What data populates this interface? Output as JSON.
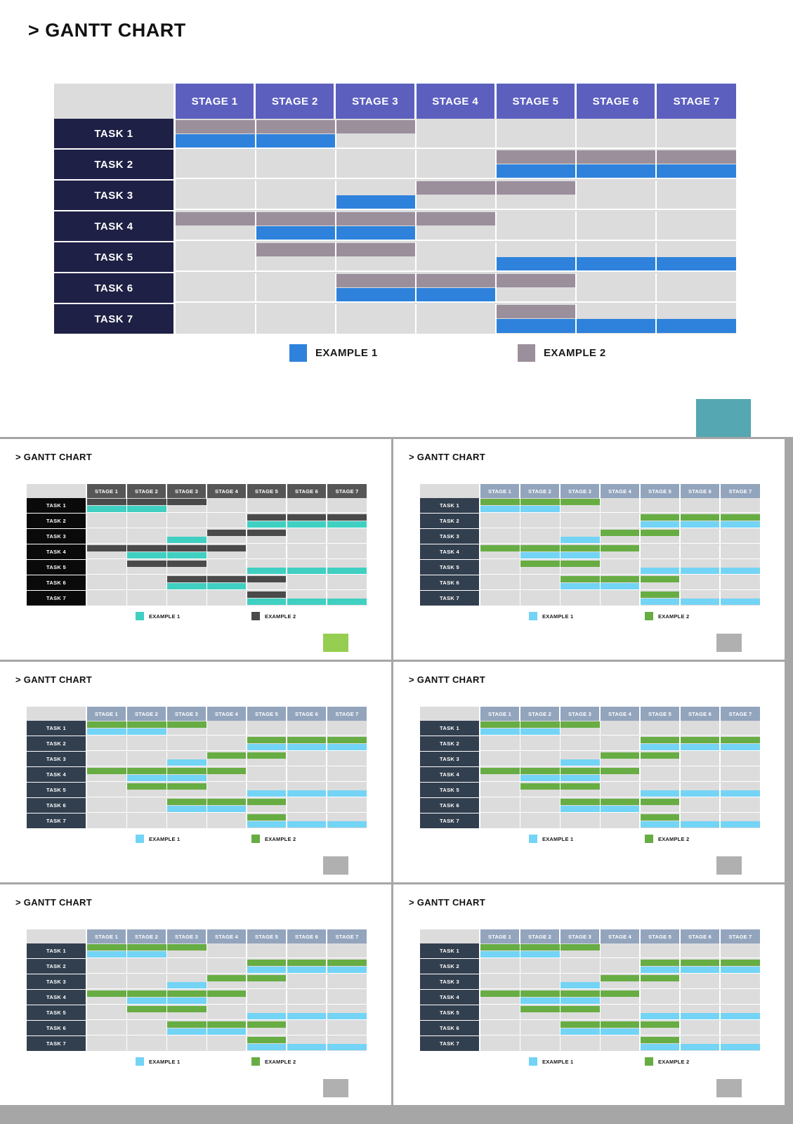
{
  "slide": {
    "title": "> GANTT CHART"
  },
  "chart_data": {
    "type": "bar",
    "subtype": "gantt",
    "title": "> GANTT CHART",
    "xlabel": "",
    "ylabel": "",
    "categories": [
      "STAGE 1",
      "STAGE 2",
      "STAGE 3",
      "STAGE 4",
      "STAGE 5",
      "STAGE 6",
      "STAGE 7"
    ],
    "tasks": [
      "TASK 1",
      "TASK 2",
      "TASK 3",
      "TASK 4",
      "TASK 5",
      "TASK 6",
      "TASK 7"
    ],
    "legend": [
      {
        "label": "EXAMPLE 1",
        "series": "example1"
      },
      {
        "label": "EXAMPLE 2",
        "series": "example2"
      }
    ],
    "legend_position": "bottom",
    "grid": true,
    "xlim": [
      1,
      7
    ],
    "series": [
      {
        "name": "EXAMPLE 2",
        "key": "example2",
        "row_slot": "top",
        "bars": [
          {
            "task": "TASK 1",
            "start_stage": 1,
            "end_stage": 3
          },
          {
            "task": "TASK 2",
            "start_stage": 5,
            "end_stage": 7
          },
          {
            "task": "TASK 3",
            "start_stage": 4,
            "end_stage": 5
          },
          {
            "task": "TASK 4",
            "start_stage": 1,
            "end_stage": 4
          },
          {
            "task": "TASK 5",
            "start_stage": 2,
            "end_stage": 3
          },
          {
            "task": "TASK 6",
            "start_stage": 3,
            "end_stage": 5
          },
          {
            "task": "TASK 7",
            "start_stage": 5,
            "end_stage": 5
          }
        ]
      },
      {
        "name": "EXAMPLE 1",
        "key": "example1",
        "row_slot": "bottom",
        "bars": [
          {
            "task": "TASK 1",
            "start_stage": 1,
            "end_stage": 2
          },
          {
            "task": "TASK 2",
            "start_stage": 5,
            "end_stage": 7
          },
          {
            "task": "TASK 3",
            "start_stage": 3,
            "end_stage": 3
          },
          {
            "task": "TASK 4",
            "start_stage": 2,
            "end_stage": 3
          },
          {
            "task": "TASK 5",
            "start_stage": 5,
            "end_stage": 7
          },
          {
            "task": "TASK 6",
            "start_stage": 3,
            "end_stage": 4
          },
          {
            "task": "TASK 7",
            "start_stage": 5,
            "end_stage": 7
          }
        ]
      }
    ]
  },
  "theme_hero": {
    "header_bg": "#5c5fbe",
    "task_bg": "#1e2045",
    "track_bg": "#dcdcdc",
    "corner_bg": "#dcdcdc",
    "example1": "#2e82dc",
    "example2": "#9b8f9c",
    "accent": "#55a7b2",
    "title_color": "#111111"
  },
  "variants": [
    {
      "id": "variant-1",
      "title": "> GANTT CHART",
      "legend": [
        {
          "label": "EXAMPLE 1"
        },
        {
          "label": "EXAMPLE 2"
        }
      ],
      "theme": {
        "header_bg": "#565656",
        "task_bg": "#0a0a0a",
        "track_bg": "#dcdcdc",
        "corner_bg": "#dcdcdc",
        "example1": "#3fd0c2",
        "example2": "#4a4a4a",
        "accent": "#96ce51"
      }
    },
    {
      "id": "variant-2",
      "title": "> GANTT CHART",
      "legend": [
        {
          "label": "EXAMPLE 1"
        },
        {
          "label": "EXAMPLE 2"
        }
      ],
      "theme": {
        "header_bg": "#93a4bd",
        "task_bg": "#323f4f",
        "track_bg": "#dcdcdc",
        "corner_bg": "#dcdcdc",
        "example1": "#73d4f5",
        "example2": "#67ad43",
        "accent": "#b0b0b0"
      }
    },
    {
      "id": "variant-3",
      "title": "> GANTT CHART",
      "legend": [
        {
          "label": "EXAMPLE 1"
        },
        {
          "label": "EXAMPLE 2"
        }
      ],
      "theme": {
        "header_bg": "#93a4bd",
        "task_bg": "#323f4f",
        "track_bg": "#dcdcdc",
        "corner_bg": "#dcdcdc",
        "example1": "#73d4f5",
        "example2": "#67ad43",
        "accent": "#b0b0b0"
      }
    },
    {
      "id": "variant-4",
      "title": "> GANTT CHART",
      "legend": [
        {
          "label": "EXAMPLE 1"
        },
        {
          "label": "EXAMPLE 2"
        }
      ],
      "theme": {
        "header_bg": "#93a4bd",
        "task_bg": "#323f4f",
        "track_bg": "#dcdcdc",
        "corner_bg": "#dcdcdc",
        "example1": "#73d4f5",
        "example2": "#67ad43",
        "accent": "#b0b0b0"
      }
    },
    {
      "id": "variant-5",
      "title": "> GANTT CHART",
      "legend": [
        {
          "label": "EXAMPLE 1"
        },
        {
          "label": "EXAMPLE 2"
        }
      ],
      "theme": {
        "header_bg": "#93a4bd",
        "task_bg": "#323f4f",
        "track_bg": "#dcdcdc",
        "corner_bg": "#dcdcdc",
        "example1": "#73d4f5",
        "example2": "#67ad43",
        "accent": "#b0b0b0"
      }
    },
    {
      "id": "variant-6",
      "title": "> GANTT CHART",
      "legend": [
        {
          "label": "EXAMPLE 1"
        },
        {
          "label": "EXAMPLE 2"
        }
      ],
      "theme": {
        "header_bg": "#93a4bd",
        "task_bg": "#323f4f",
        "track_bg": "#dcdcdc",
        "corner_bg": "#dcdcdc",
        "example1": "#73d4f5",
        "example2": "#67ad43",
        "accent": "#b0b0b0"
      }
    }
  ]
}
